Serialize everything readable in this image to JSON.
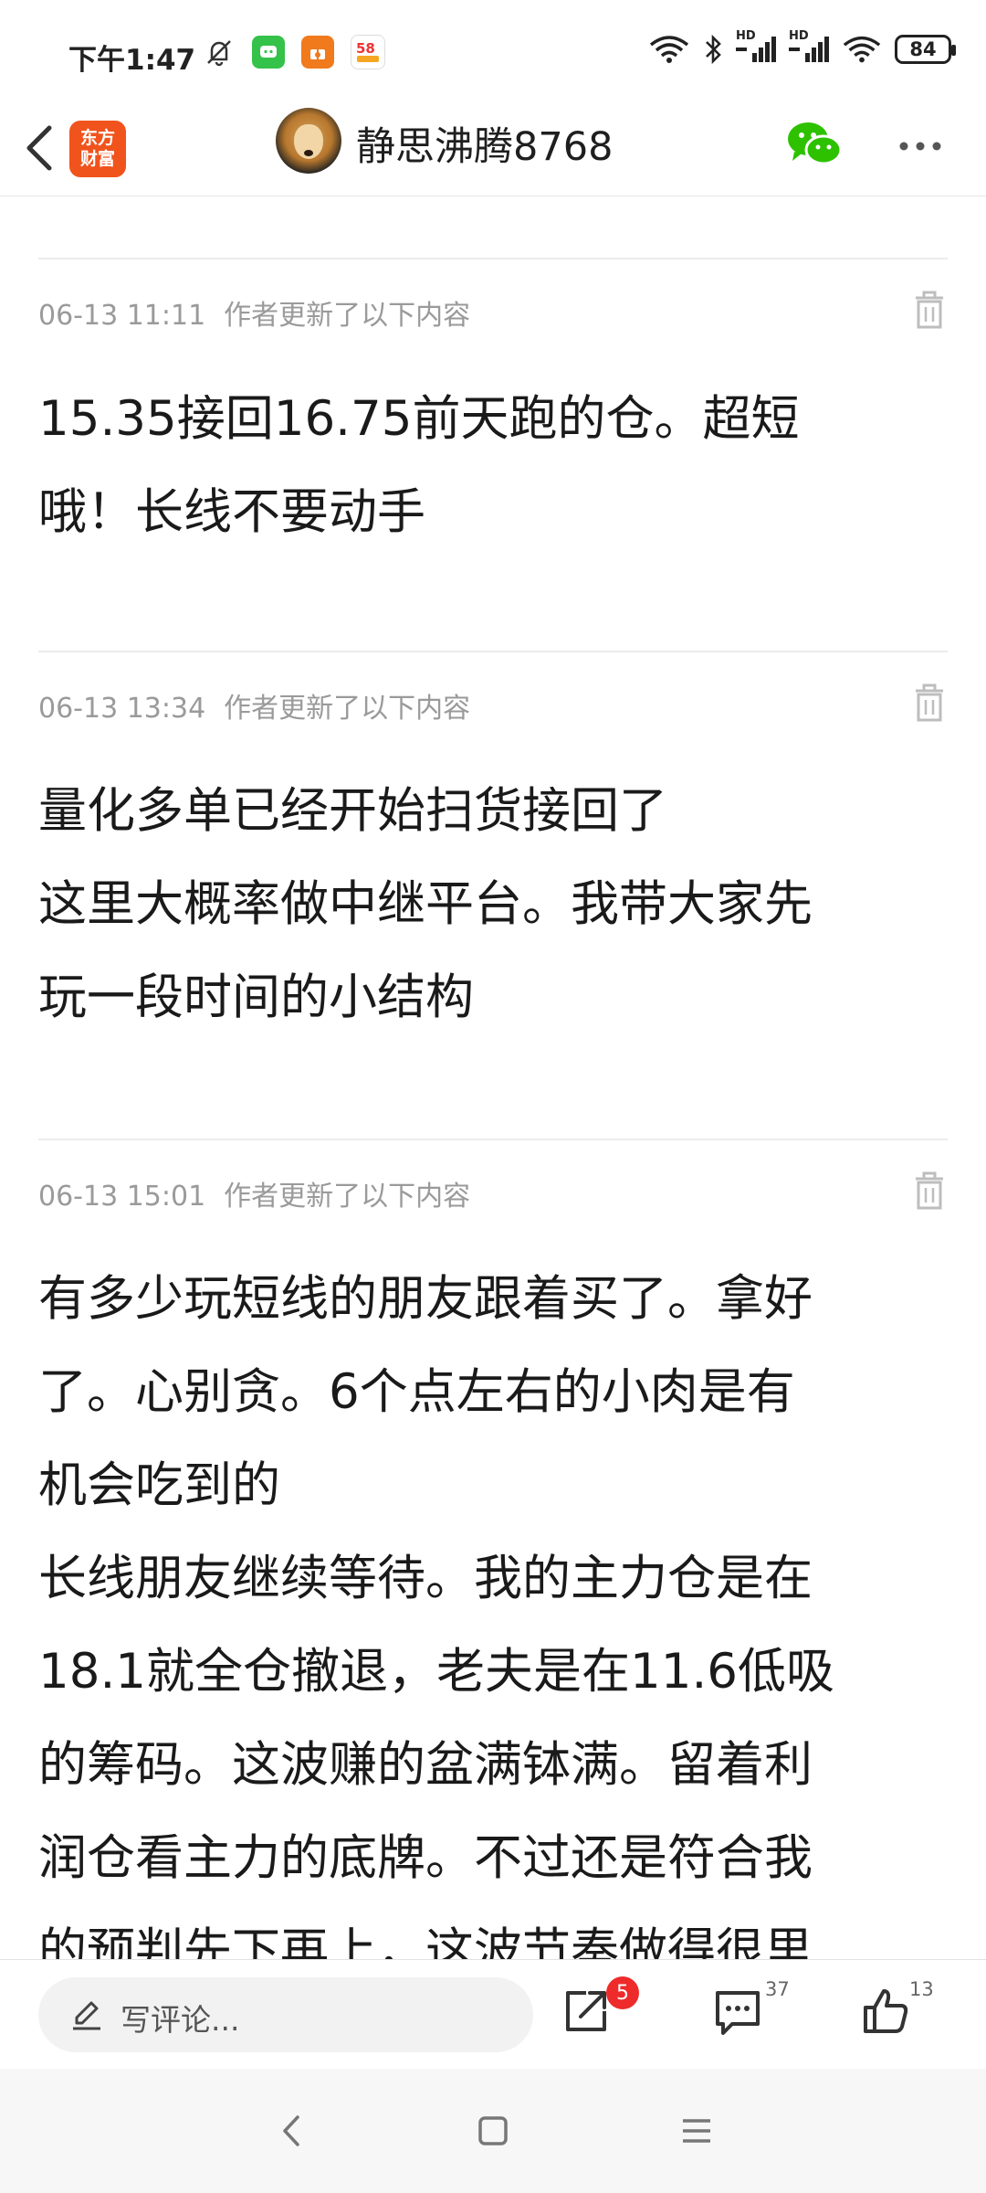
{
  "status_bar": {
    "time": "下午1:47",
    "app_icons": [
      "bell-off-icon",
      "message-app-icon",
      "gift-app-icon",
      "58-app-icon"
    ],
    "battery": "84",
    "network_labels": [
      "HD",
      "HD"
    ]
  },
  "header": {
    "brand_logo_text": "东方财富",
    "username": "静思沸腾8768"
  },
  "posts": [
    {
      "time": "06-13 11:11",
      "note": "作者更新了以下内容",
      "lines": [
        "15.35接回16.75前天跑的仓。超短",
        "哦！长线不要动手"
      ]
    },
    {
      "time": "06-13 13:34",
      "note": "作者更新了以下内容",
      "lines": [
        "量化多单已经开始扫货接回了",
        "这里大概率做中继平台。我带大家先",
        "玩一段时间的小结构"
      ]
    },
    {
      "time": "06-13 15:01",
      "note": "作者更新了以下内容",
      "lines": [
        "有多少玩短线的朋友跟着买了。拿好",
        "了。心别贪。6个点左右的小肉是有",
        "机会吃到的",
        "长线朋友继续等待。我的主力仓是在",
        "18.1就全仓撤退，老夫是在11.6低吸",
        "的筹码。这波赚的盆满钵满。留着利",
        "润仓看主力的底牌。不过还是符合我",
        "的预判先下再上，这波节奏做得很里"
      ]
    }
  ],
  "action_bar": {
    "comment_placeholder": "写评论...",
    "share_badge": "5",
    "comment_count": "37",
    "like_count": "13"
  },
  "colors": {
    "brand_orange": "#f0531c",
    "wechat_green": "#2dc100",
    "badge_red": "#ee2a2a"
  }
}
